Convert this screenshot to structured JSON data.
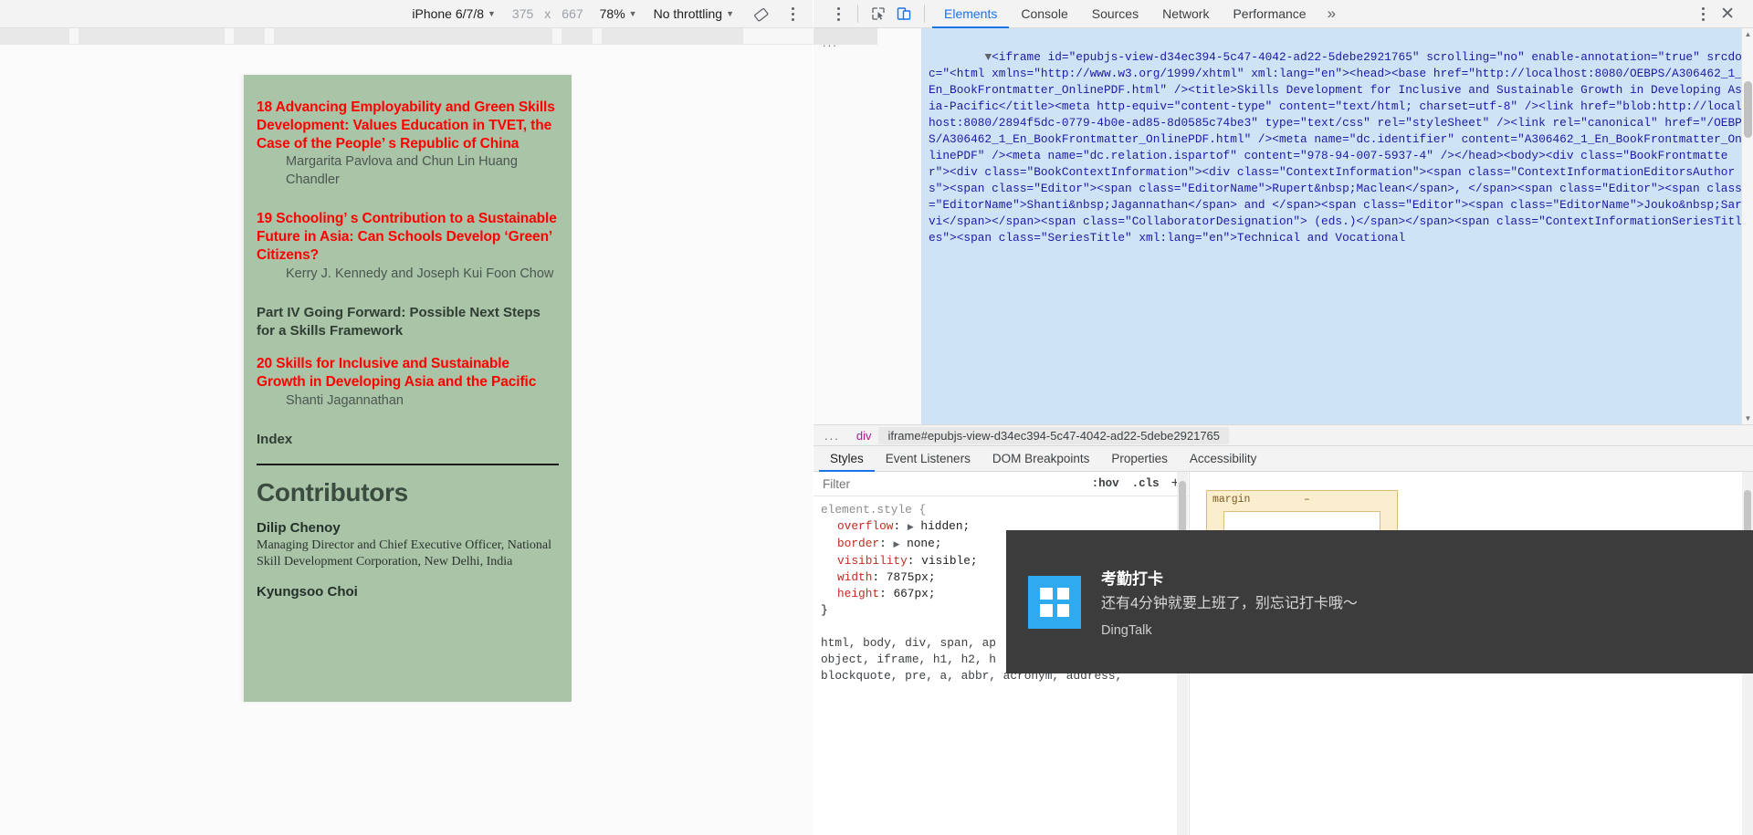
{
  "device_toolbar": {
    "device_label": "iPhone 6/7/8",
    "width_value": "375",
    "multiply": "x",
    "height_value": "667",
    "zoom_label": "78%",
    "throttling_label": "No throttling",
    "rotate_icon": "rotate-device-icon",
    "more_icon": "more-options-icon"
  },
  "book_page": {
    "entries": [
      {
        "title": "18 Advancing Employability and Green Skills Development: Values Education in TVET, the Case of the People’ s Republic of China",
        "authors": "Margarita Pavlova and Chun Lin Huang Chandler"
      },
      {
        "title": "19 Schooling’ s Contribution to a Sustainable Future in Asia: Can Schools Develop  ‘Green’  Citizens?",
        "authors": "Kerry J. Kennedy and Joseph Kui Foon Chow"
      }
    ],
    "part_heading": "Part IV Going Forward: Possible Next Steps for a Skills Framework",
    "entry_20": {
      "title": "20 Skills for Inclusive and Sustainable Growth in Developing Asia and the Pacific",
      "authors": "Shanti Jagannathan"
    },
    "index_label": "Index",
    "contributors_heading": "Contributors",
    "contributors": [
      {
        "name": "Dilip Chenoy",
        "description": "Managing Director and Chief Executive Officer, National Skill Development Corporation, New Delhi, India"
      },
      {
        "name": "Kyungsoo Choi",
        "description": ""
      }
    ]
  },
  "devtools": {
    "panel_tabs": [
      {
        "label": "Elements",
        "active": true
      },
      {
        "label": "Console",
        "active": false
      },
      {
        "label": "Sources",
        "active": false
      },
      {
        "label": "Network",
        "active": false
      },
      {
        "label": "Performance",
        "active": false
      }
    ],
    "more_tabs_icon": "chevron-double-right-icon",
    "close_icon": "close-icon",
    "inspect_icon": "inspect-element-icon",
    "device_toggle_icon": "toggle-device-toolbar-icon",
    "settings_icon": "more-options-icon",
    "dom": {
      "ellipsis": "...",
      "selected_node_html": "<iframe id=\"epubjs-view-d34ec394-5c47-4042-ad22-5debe2921765\" scrolling=\"no\" enable-annotation=\"true\" srcdoc=\"<html xmlns=\"http://www.w3.org/1999/xhtml\" xml:lang=\"en\"><head><base href=\"http://localhost:8080/OEBPS/A306462_1_En_BookFrontmatter_OnlinePDF.html\" /><title>Skills Development for Inclusive and Sustainable Growth in Developing Asia-Pacific</title><meta http-equiv=\"content-type\" content=\"text/html; charset=utf-8\" /><link href=\"blob:http://localhost:8080/2894f5dc-0779-4b0e-ad85-8d0585c74be3\" type=\"text/css\" rel=\"styleSheet\" /><link rel=\"canonical\" href=\"/OEBPS/A306462_1_En_BookFrontmatter_OnlinePDF.html\" /><meta name=\"dc.identifier\" content=\"A306462_1_En_BookFrontmatter_OnlinePDF\" /><meta name=\"dc.relation.ispartof\" content=\"978-94-007-5937-4\" /></head><body><div class=\"BookFrontmatter\"><div class=\"BookContextInformation\"><div class=\"ContextInformation\"><span class=\"ContextInformationEditorsAuthors\"><span class=\"Editor\"><span class=\"EditorName\">Rupert&nbsp;Maclean</span>, </span><span class=\"Editor\"><span class=\"EditorName\">Shanti&nbsp;Jagannathan</span> and </span><span class=\"Editor\"><span class=\"EditorName\">Jouko&nbsp;Sarvi</span></span><span class=\"CollaboratorDesignation\"> (eds.)</span></span><span class=\"ContextInformationSeriesTitles\"><span class=\"SeriesTitle\" xml:lang=\"en\">Technical and Vocational"
    },
    "breadcrumb": {
      "ellipsis": "...",
      "parent": "div",
      "selected": "iframe#epubjs-view-d34ec394-5c47-4042-ad22-5debe2921765"
    },
    "styles_tabs": [
      {
        "label": "Styles",
        "active": true
      },
      {
        "label": "Event Listeners",
        "active": false
      },
      {
        "label": "DOM Breakpoints",
        "active": false
      },
      {
        "label": "Properties",
        "active": false
      },
      {
        "label": "Accessibility",
        "active": false
      }
    ],
    "filter": {
      "placeholder": "Filter",
      "value": "",
      "hov_label": ":hov",
      "cls_label": ".cls",
      "new_rule_label": "+"
    },
    "css_rules": [
      {
        "selector": "element.style",
        "open_brace": "{",
        "close_brace": "}",
        "declarations": [
          {
            "name": "overflow",
            "value": "hidden",
            "expandable": true
          },
          {
            "name": "border",
            "value": "none",
            "expandable": true
          },
          {
            "name": "visibility",
            "value": "visible",
            "expandable": false
          },
          {
            "name": "width",
            "value": "7875px",
            "expandable": false
          },
          {
            "name": "height",
            "value": "667px",
            "expandable": false
          }
        ]
      }
    ],
    "inherited_selector_lines": [
      "html, body, div, span, ap",
      "object, iframe, h1, h2, h",
      "blockquote, pre, a, abbr, acronym, address,"
    ],
    "box_model": {
      "label": "margin",
      "dash": "–"
    }
  },
  "toast": {
    "app_icon": "dingtalk-grid-icon",
    "title": "考勤打卡",
    "body": "还有4分钟就要上班了，别忘记打卡哦～",
    "app_name": "DingTalk"
  },
  "colors": {
    "accent": "#1a73e8",
    "book_bg": "#aac4a8",
    "toc_red": "#ff0000",
    "dom_selection": "#cfe3f7",
    "toast_bg": "#3c3c3c",
    "dingtalk_blue": "#2eaaf0"
  }
}
